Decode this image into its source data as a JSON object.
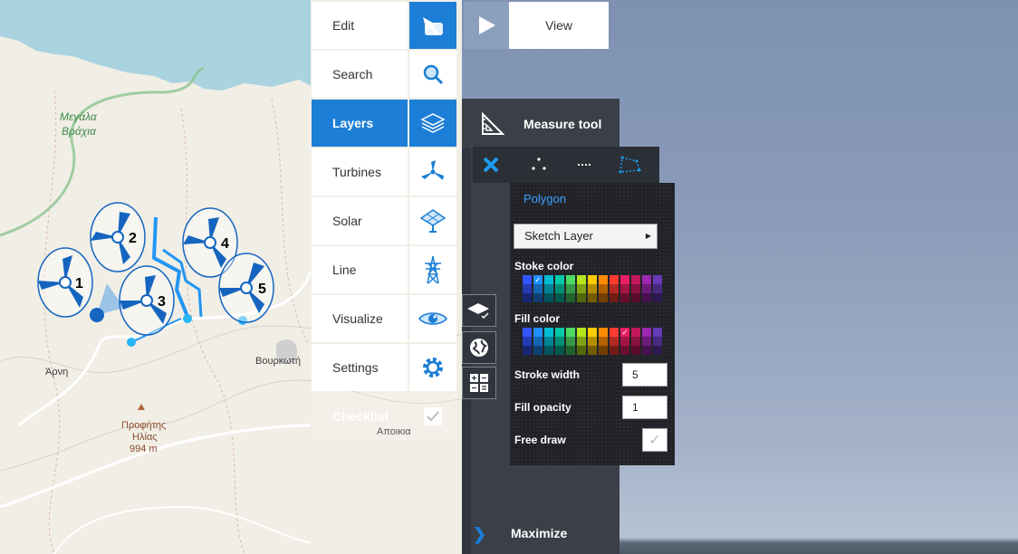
{
  "map": {
    "labels": {
      "megala": "Μεγάλα",
      "vrachia": "Βράχια",
      "arni": "Άρνη",
      "vourkoti": "Βουρκωτή",
      "profitis": "Προφήτης",
      "ilias": "Ηλίας",
      "elevation": "994 m",
      "apoikia": "Αποικια"
    },
    "turbines": [
      "1",
      "2",
      "3",
      "4",
      "5"
    ],
    "colors": {
      "sea": "#aad3df",
      "land": "#f1eee6",
      "route": "#2196f3",
      "turbine": "#1565c0"
    }
  },
  "menu": {
    "items": [
      {
        "label": "Edit",
        "icon": "hand-pointer-icon",
        "active": false
      },
      {
        "label": "Search",
        "icon": "search-icon",
        "active": false
      },
      {
        "label": "Layers",
        "icon": "layers-icon",
        "active": true
      },
      {
        "label": "Turbines",
        "icon": "turbine-icon",
        "active": false
      },
      {
        "label": "Solar",
        "icon": "solar-panel-icon",
        "active": false
      },
      {
        "label": "Line",
        "icon": "power-tower-icon",
        "active": false
      },
      {
        "label": "Visualize",
        "icon": "eye-icon",
        "active": false
      },
      {
        "label": "Settings",
        "icon": "gear-icon",
        "active": false
      },
      {
        "label": "Checklist",
        "icon": "checkbox-icon",
        "active": false
      }
    ],
    "accent": "#1c7ed6"
  },
  "view": {
    "label": "View",
    "icon": "play-icon"
  },
  "side_panel": {
    "measure_label": "Measure tool",
    "maximize_label": "Maximize",
    "maximize_icon": "chevron-right-icon",
    "tools": [
      "layer-check-icon",
      "globe-icon",
      "calculator-icon"
    ]
  },
  "measure_toolbar": {
    "tools": [
      "close-icon",
      "points-icon",
      "line-icon",
      "polygon-icon"
    ]
  },
  "polygon_panel": {
    "title": "Polygon",
    "layer_select": "Sketch Layer",
    "stroke_color_label": "Stoke color",
    "fill_color_label": "Fill color",
    "stroke_width_label": "Stroke width",
    "stroke_width_value": "5",
    "fill_opacity_label": "Fill opacity",
    "fill_opacity_value": "1",
    "free_draw_label": "Free draw",
    "palette": [
      "#3355ff",
      "#1e90ff",
      "#00bcd4",
      "#00c9a7",
      "#4cd964",
      "#b5e61d",
      "#ffcc00",
      "#ff8c00",
      "#ff3b30",
      "#e91e63",
      "#c2185b",
      "#9c27b0",
      "#673ab7"
    ],
    "stroke_selected": 1,
    "fill_selected": 9
  }
}
